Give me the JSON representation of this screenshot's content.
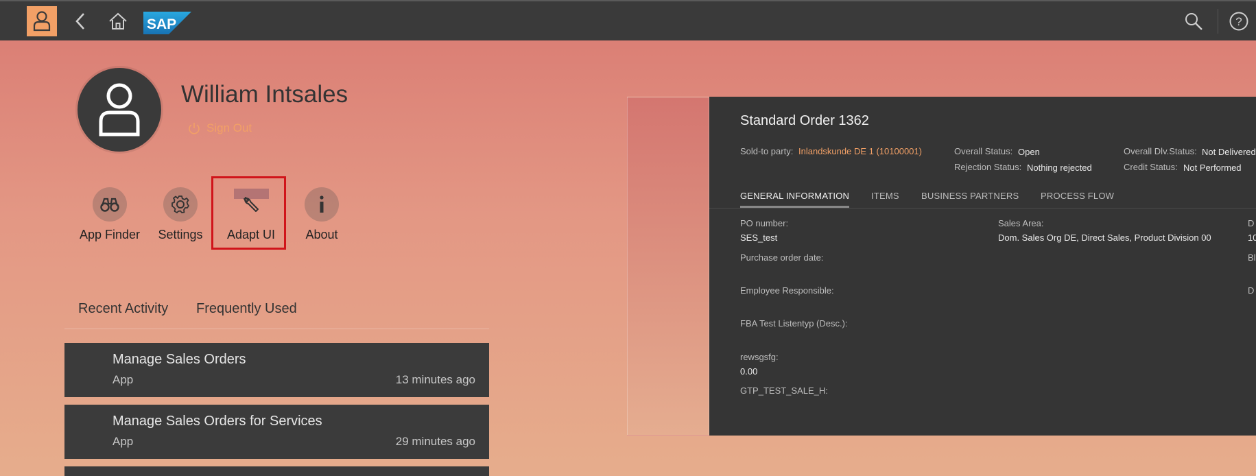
{
  "topbar": {
    "logo_text": "SAP",
    "icons": [
      "user-icon",
      "back-icon",
      "home-icon",
      "search-icon",
      "help-icon"
    ]
  },
  "user": {
    "name": "William Intsales",
    "signout_label": "Sign Out"
  },
  "actions": [
    {
      "label": "App Finder",
      "icon": "binoculars-icon"
    },
    {
      "label": "Settings",
      "icon": "gear-icon"
    },
    {
      "label": "Adapt UI",
      "icon": "wrench-icon"
    },
    {
      "label": "About",
      "icon": "info-icon"
    }
  ],
  "tabs": {
    "recent": "Recent Activity",
    "frequent": "Frequently Used"
  },
  "activities": [
    {
      "title": "Manage Sales Orders",
      "type": "App",
      "time": "13 minutes ago"
    },
    {
      "title": "Manage Sales Orders for Services",
      "type": "App",
      "time": "29 minutes ago"
    }
  ],
  "preview": {
    "title": "Standard Order 1362",
    "sold_to_label": "Sold-to party:",
    "sold_to_value": "Inlandskunde DE 1 (10100001)",
    "overall_status_label": "Overall Status:",
    "overall_status_value": "Open",
    "rejection_status_label": "Rejection Status:",
    "rejection_status_value": "Nothing rejected",
    "dlv_status_label": "Overall Dlv.Status:",
    "dlv_status_value": "Not Delivered",
    "credit_status_label": "Credit Status:",
    "credit_status_value": "Not Performed",
    "tabs": [
      "GENERAL INFORMATION",
      "ITEMS",
      "BUSINESS PARTNERS",
      "PROCESS FLOW"
    ],
    "po_number_label": "PO number:",
    "po_number_value": "SES_test",
    "sales_area_label": "Sales Area:",
    "sales_area_value": "Dom. Sales Org DE, Direct Sales, Product Division 00",
    "purchase_date_label": "Purchase order date:",
    "employee_label": "Employee Responsible:",
    "fba_label": "FBA Test Listentyp (Desc.):",
    "rews_label": "rewsgsfg:",
    "rews_value": "0.00",
    "gtp_label": "GTP_TEST_SALE_H:",
    "cut_col_1": "D",
    "cut_col_2": "10",
    "cut_col_3": "Bl",
    "cut_col_4": "D"
  },
  "colors": {
    "accent": "#f2a066",
    "shell": "#3a3a3a",
    "highlight": "#d0141a"
  }
}
